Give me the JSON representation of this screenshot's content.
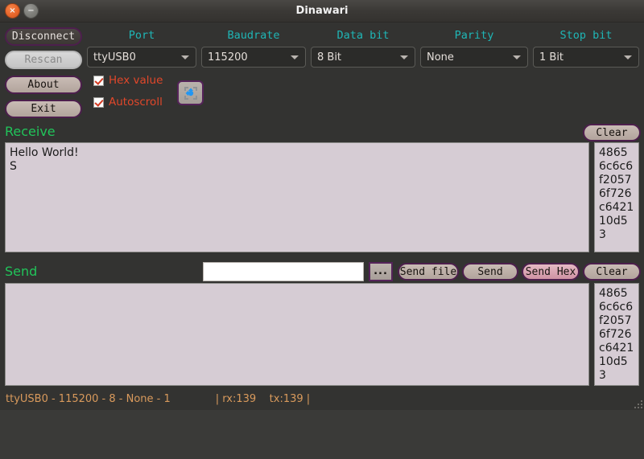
{
  "window": {
    "title": "Dinawari",
    "close_icon": "close-icon",
    "minimize_icon": "minimize-icon",
    "close_glyph": "×",
    "minimize_glyph": "−"
  },
  "actions": {
    "disconnect": "Disconnect",
    "rescan": "Rescan",
    "about": "About",
    "exit": "Exit"
  },
  "settings": {
    "port": {
      "label": "Port",
      "value": "ttyUSB0"
    },
    "baudrate": {
      "label": "Baudrate",
      "value": "115200"
    },
    "data_bit": {
      "label": "Data bit",
      "value": "8 Bit"
    },
    "parity": {
      "label": "Parity",
      "value": "None"
    },
    "stop_bit": {
      "label": "Stop bit",
      "value": "1 Bit"
    }
  },
  "options": {
    "hex_value": {
      "label": "Hex value",
      "checked": true
    },
    "autoscroll": {
      "label": "Autoscroll",
      "checked": true
    },
    "expand_button_icon": "move-arrows-icon"
  },
  "receive": {
    "label": "Receive",
    "clear_label": "Clear",
    "text": "Hello World!\nS",
    "hex": "48656c6c6f20576f726c642110d53"
  },
  "send": {
    "label": "Send",
    "input_value": "",
    "input_placeholder": "",
    "browse_label": "...",
    "send_file_label": "Send file",
    "send_label": "Send",
    "send_hex_label": "Send Hex",
    "clear_label": "Clear",
    "text": "",
    "hex": "48656c6c6f20576f726c642110d53"
  },
  "status": {
    "connection": "ttyUSB0 - 115200 - 8 - None - 1",
    "counters": "| rx:139    tx:139 |"
  },
  "colors": {
    "accent_teal": "#1fb6b6",
    "accent_green": "#21c45a",
    "accent_red": "#e1472a",
    "status_orange": "#d99a5c",
    "button_border_purple": "#4d1f4d",
    "pane_background": "#d6ccd4"
  }
}
